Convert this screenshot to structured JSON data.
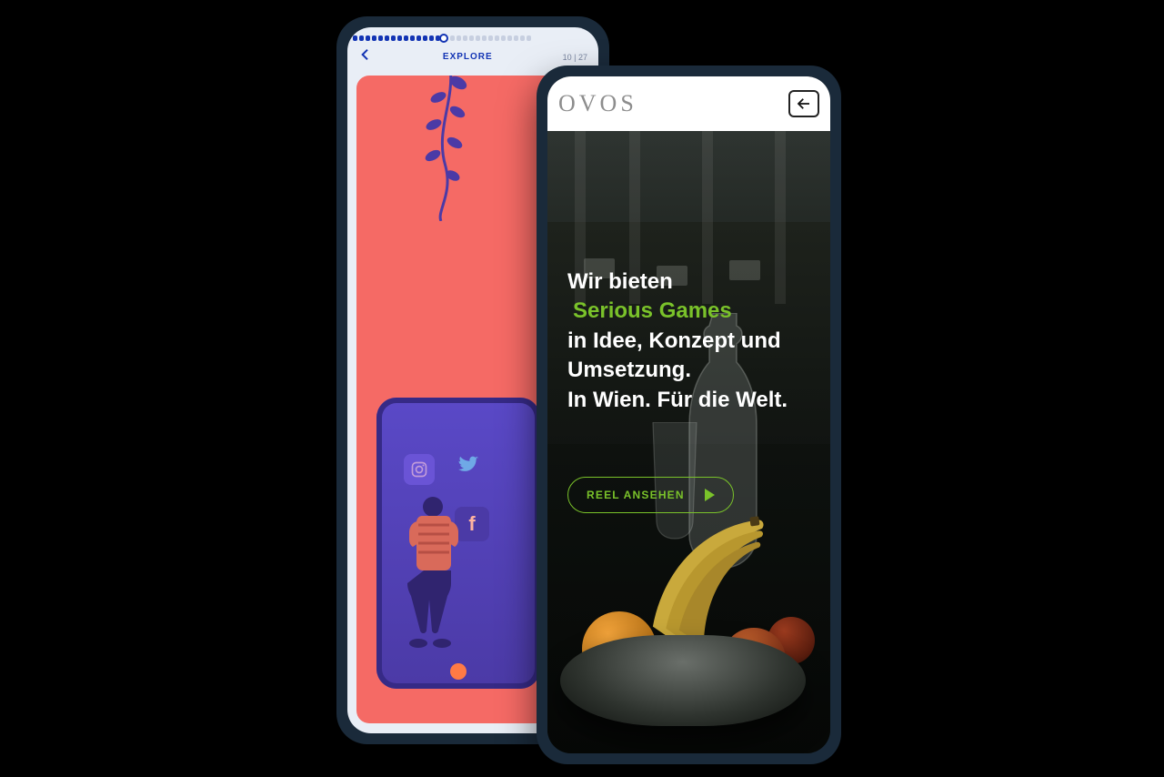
{
  "explore": {
    "header_title": "EXPLORE",
    "progress_current": "10",
    "progress_total": "27",
    "progress_segments_total": 27,
    "progress_segments_filled": 14,
    "icons": {
      "back": "chevron-left-icon",
      "expand": "expand-icon",
      "instagram": "instagram-icon",
      "twitter": "twitter-icon",
      "facebook": "facebook-icon",
      "twitch": "twitch-icon"
    },
    "colors": {
      "accent": "#1334b4",
      "card": "#f56a65",
      "deep": "#4b3aa6"
    }
  },
  "ovos": {
    "brand": "OVOS",
    "copy": {
      "l1": "Wir bieten",
      "l2_highlight": "Serious Games",
      "l3": "in Idee, Konzept und",
      "l4": "Umsetzung.",
      "l5": "In Wien. Für die Welt."
    },
    "cta_label": "REEL ANSEHEN",
    "icons": {
      "back": "arrow-left-icon",
      "play": "play-icon"
    },
    "colors": {
      "accent": "#7ac22a",
      "logo": "#8d8d8d"
    }
  }
}
